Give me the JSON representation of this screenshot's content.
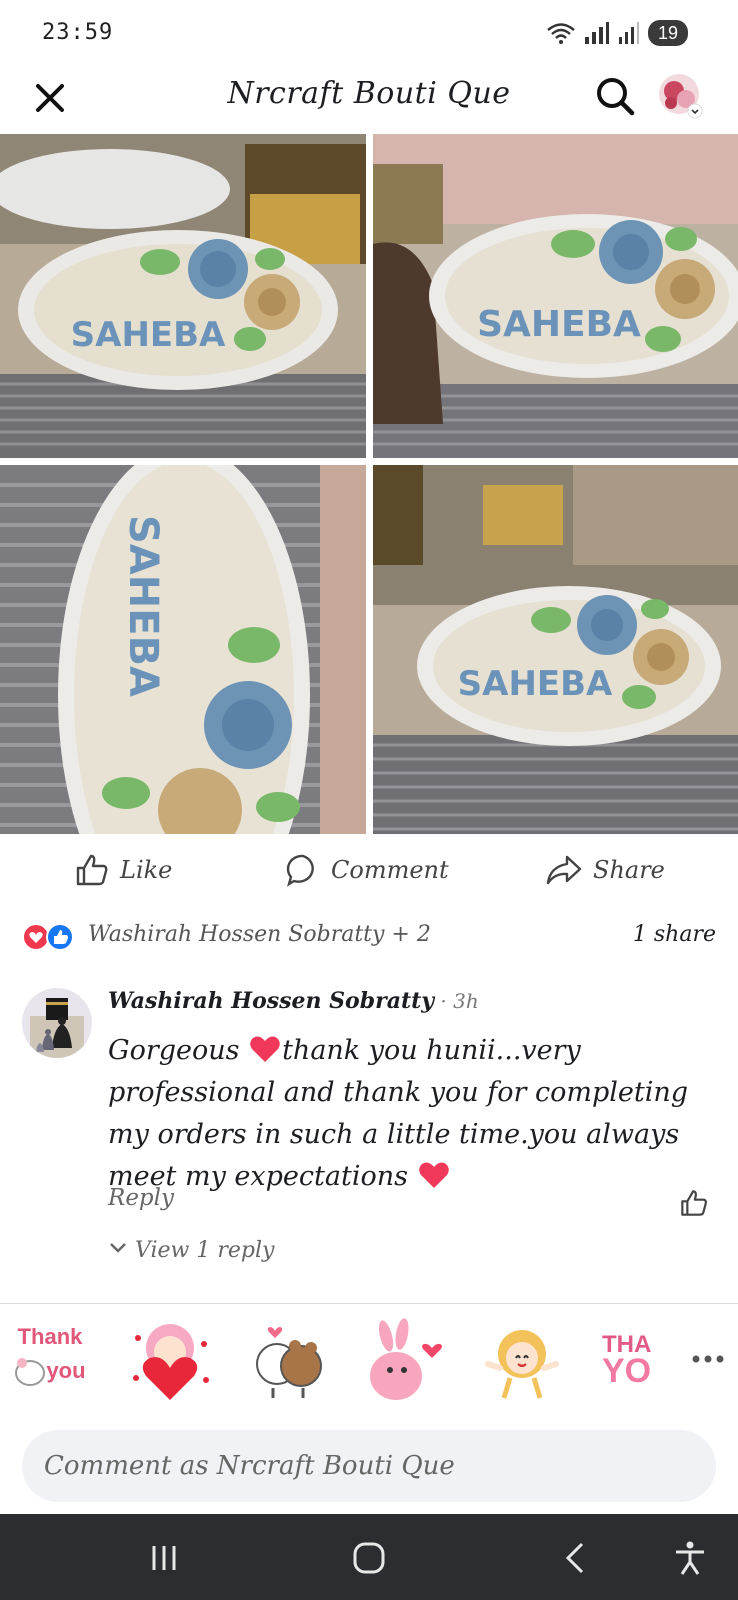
{
  "status": {
    "time": "23:59",
    "battery": "19"
  },
  "header": {
    "title": "Nrcraft Bouti Que"
  },
  "photos": {
    "plaque_text": "SAHEBA"
  },
  "actions": {
    "like": "Like",
    "comment": "Comment",
    "share": "Share"
  },
  "reactions": {
    "names": "Washirah Hossen Sobratty + 2",
    "shares": "1 share"
  },
  "comment": {
    "author": "Washirah Hossen Sobratty",
    "time": " · 3h",
    "text_part1": "Gorgeous ",
    "text_part2": "thank you hunii...very professional and thank you for completing my orders in such a little time.you always meet my expectations ",
    "reply": "Reply",
    "view_replies": "View 1 reply"
  },
  "stickers": {
    "thank_you_1": [
      "Thank",
      "you"
    ],
    "thank_you_2": [
      "THA",
      "YO"
    ]
  },
  "composer": {
    "placeholder": "Comment as Nrcraft Bouti Que"
  },
  "colors": {
    "rose": "#6b8fb0",
    "cream": "#e9e4d8",
    "tan": "#c8a978",
    "leaf": "#7cb86a",
    "heart": "#e8405a",
    "fb_blue": "#1877f2"
  }
}
